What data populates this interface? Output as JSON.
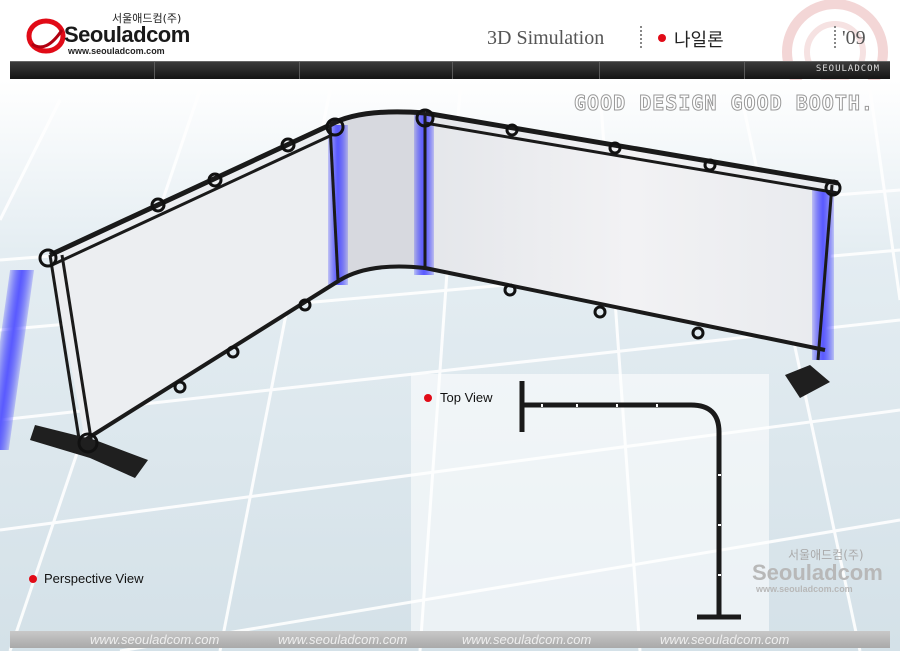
{
  "header": {
    "logo_korean": "서울애드컴(주)",
    "logo_main": "Seouladcom",
    "logo_url": "www.seouladcom.com",
    "title": "3D Simulation",
    "subtitle": "나일론",
    "year": "'09"
  },
  "navbar": {
    "brand": "SEOULADCOM"
  },
  "scene": {
    "slogan": "GOOD DESIGN GOOD BOOTH.",
    "top_view_label": "Top View",
    "perspective_label": "Perspective View"
  },
  "watermark": {
    "korean": "서울애드컴(주)",
    "main": "Seouladcom",
    "url": "www.seouladcom.com"
  },
  "footer": {
    "links": [
      "www.seouladcom.com",
      "www.seouladcom.com",
      "www.seouladcom.com",
      "www.seouladcom.com"
    ]
  },
  "colors": {
    "accent_red": "#e10b17",
    "led_blue": "#3b3bff",
    "truss": "#1a1a1a",
    "nav_dark": "#222222"
  }
}
